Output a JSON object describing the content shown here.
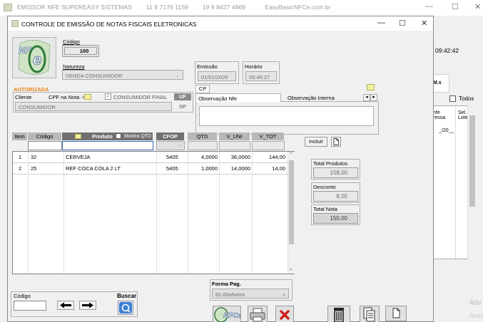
{
  "outer_window": {
    "title_app": "EMISSOR NFE  SUPEREASY SISTEMAS",
    "title_phone1": "11 9 7176 1159",
    "title_phone2": "19 9 8427 4869",
    "title_site": "EasyBasicNFCe.com.br",
    "minimize": "—",
    "maximize": "☐",
    "close": "✕",
    "clock": "09:42:42",
    "tab_label": "M.s",
    "todos_label": "Todos",
    "grid_header_col1": "nfe\nressa",
    "grid_header_col2": "Sel.\nLote",
    "grid_row1": "_/20__",
    "watermark1": "Ativ",
    "watermark2": "Aces"
  },
  "dialog": {
    "title": "CONTROLE DE EMISSÃO DE NOTAS FISCAIS ELETRONICAS",
    "minimize": "—",
    "maximize": "☐",
    "close": "✕"
  },
  "header": {
    "codigo_label": "Código",
    "codigo_value": "100",
    "natureza_label": "Natureza",
    "natureza_value": "VENDA CONSUMIDOR",
    "emissao_label": "Emissão",
    "emissao_value": "01/01/2025",
    "horario_label": "Horário",
    "horario_value": "09:49:27",
    "status": "AUTORIZADA",
    "cliente_label": "Cliente",
    "cpf_label": "CPF na Nota ->",
    "consumidor_final_label": "CONSUMIDOR FINAL",
    "uf_label": "UF",
    "cliente_value": "CONSUMIDOR",
    "uf_value": "SP",
    "cp_tab": "CP",
    "obs_nfe_tab": "Observação Nfe",
    "obs_interna_tab": "Observação Interna",
    "tab_left": "◂",
    "tab_right": "▸"
  },
  "item_columns": {
    "item": "Item",
    "codigo": "Código",
    "produto": "Produto",
    "mostra_qtd": "Mostra QTD",
    "cfop": "CFOP",
    "qtd": "QTD",
    "v_uni": "V_UNI",
    "v_tot": "V_TOT"
  },
  "incluir_label": "Incluir",
  "items": [
    {
      "item": "1",
      "codigo": "32",
      "produto": "CERVEJA",
      "cfop": "5405",
      "qtd": "4,0000",
      "v_uni": "36,0000",
      "v_tot": "144,00"
    },
    {
      "item": "2",
      "codigo": "25",
      "produto": "REF COCA COLA 2 LT",
      "cfop": "5405",
      "qtd": "1,0000",
      "v_uni": "14,0000",
      "v_tot": "14,00"
    }
  ],
  "totals": {
    "total_produtos_label": "Total Produtos",
    "total_produtos_value": "158,00",
    "desconto_label": "Desconto",
    "desconto_value": "8,00",
    "total_nota_label": "Total Nota",
    "total_nota_value": "150,00"
  },
  "footer": {
    "codigo_label": "Código",
    "buscar_label": "Buscar",
    "forma_pag_label": "Forma Pag.",
    "forma_pag_value": "01-Dinheiro",
    "nfce_label": "NFCe"
  }
}
